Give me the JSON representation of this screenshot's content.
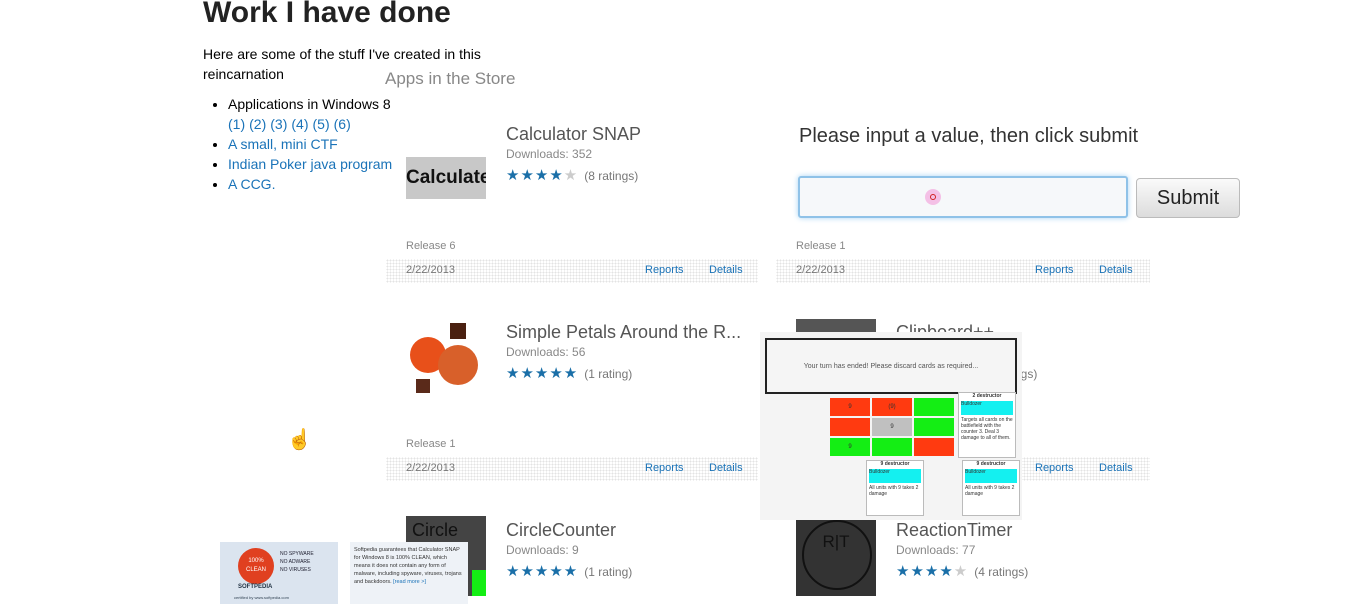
{
  "article": {
    "title": "Work I have done",
    "intro": "Here are some of the stuff I've created in this reincarnation",
    "items": [
      {
        "label": "Applications in Windows 8",
        "links": [
          "(1)",
          "(2)",
          "(3)",
          "(4)",
          "(5)",
          "(6)"
        ]
      },
      {
        "label": "A small, mini CTF"
      },
      {
        "label": "Indian Poker java program"
      },
      {
        "label": "A CCG."
      }
    ]
  },
  "store": {
    "heading": "Apps in the Store",
    "apps": [
      {
        "name": "Calculator SNAP",
        "thumb_text": "Calculate!",
        "downloads": "Downloads: 352",
        "stars": "★★★★",
        "empty_stars": "★",
        "ratings": "(8 ratings)",
        "release": "Release 6",
        "date": "2/22/2013",
        "reports": "Reports",
        "details": "Details"
      },
      {
        "name": "Simple Petals Around the R...",
        "downloads": "Downloads: 56",
        "stars": "★★★★★",
        "empty_stars": "",
        "ratings": "(1 rating)",
        "release": "Release 1",
        "date": "2/22/2013",
        "reports": "Reports",
        "details": "Details"
      },
      {
        "name": "CircleCounter",
        "thumb_text": "Circle",
        "downloads": "Downloads: 9",
        "stars": "★★★★★",
        "empty_stars": "",
        "ratings": "(1 rating)"
      },
      {
        "name": "",
        "release": "Release 1",
        "date": "2/22/2013",
        "reports": "Reports",
        "details": "Details"
      },
      {
        "name": "Clipboard++",
        "ratings": "ngs)"
      },
      {
        "name": "",
        "date": "",
        "reports": "Reports",
        "details": "Details"
      },
      {
        "name": "ReactionTimer",
        "thumb_text": "R|T",
        "downloads": "Downloads: 77",
        "stars": "★★★★",
        "empty_stars": "★",
        "ratings": "(4 ratings)"
      }
    ]
  },
  "prompt": {
    "label": "Please input a value, then click submit",
    "input_value": "",
    "submit_label": "Submit"
  },
  "ccg": {
    "message": "Your turn has ended! Please discard cards as required...",
    "grid": [
      "9",
      "(9)",
      "",
      "",
      "9",
      "",
      "9",
      "",
      "",
      "",
      "",
      "2"
    ],
    "cards": [
      {
        "title": "2 destructor",
        "cap": "Bulldozer",
        "body": "Targets all cards on the battlefield with the counter 3. Deal 3 damage to all of them."
      },
      {
        "title": "9 destructor",
        "cap": "Bulldozer",
        "body": "All units with 9 takes 2 damage"
      },
      {
        "title": "9 destructor",
        "cap": "Bulldozer",
        "body": "All units with 9 takes 2 damage"
      }
    ]
  },
  "softpedia": {
    "badge_text": "100% CLEAN",
    "badge_lines": [
      "NO SPYWARE",
      "NO ADWARE",
      "NO VIRUSES"
    ],
    "brand": "SOFTPEDIA",
    "cert": "certified by www.softpedia.com",
    "guarantee": "Softpedia guarantees that Calculator SNAP for Windows 8 is 100% CLEAN, which means it does not contain any form of malware, including spyware, viruses, trojans and backdoors.",
    "read_more": "[read more >]"
  },
  "colors": {
    "link": "#1a73b8",
    "star": "#1a6fa8",
    "focus": "#8fc2e8"
  }
}
